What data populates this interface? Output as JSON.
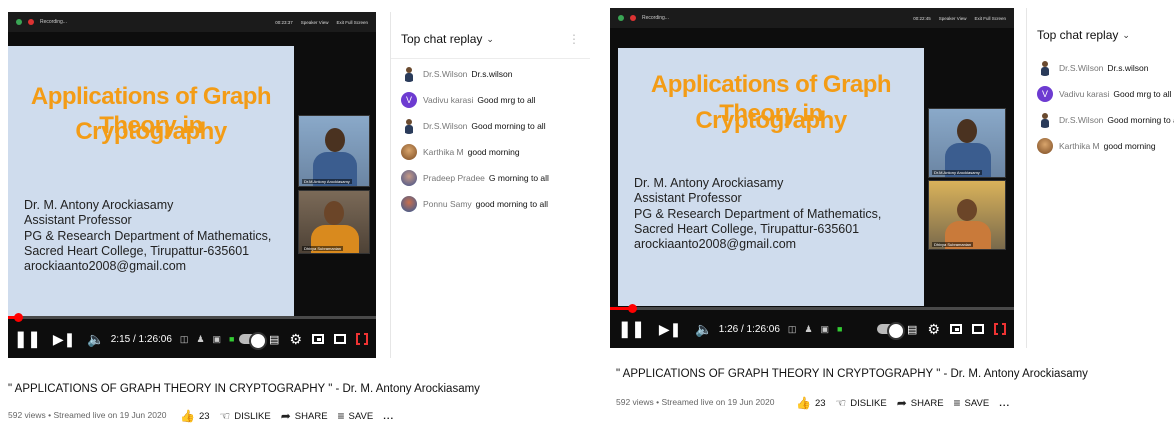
{
  "screens": [
    {
      "id": "left",
      "player": {
        "recording_label": "Recording...",
        "top_right": [
          "00:23:37",
          "Speaker View",
          "Exit Full Screen"
        ],
        "slide": {
          "title_line1": "Applications of Graph Theory in",
          "title_line2": "Cryptography",
          "lines": [
            "Dr. M. Antony Arockiasamy",
            "Assistant Professor",
            "PG & Research Department of Mathematics,",
            "Sacred Heart College, Tirupattur-635601",
            "arockiaanto2008@gmail.com"
          ]
        },
        "cam_labels": [
          "Dr.M.Antony Arockiasamy",
          "Dhivya Subramanian"
        ],
        "progress_fraction": 0.027,
        "time": "2:15 / 1:26:06",
        "mini_controls": [
          "Security",
          "Participants",
          "Chat",
          "Share Screen",
          "Record",
          "Reactions"
        ]
      },
      "chat": {
        "header": "Top chat replay",
        "messages": [
          {
            "author": "Dr.S.Wilson",
            "text": "Dr.s.wilson",
            "avatar": "person",
            "color": "#ffffff"
          },
          {
            "author": "Vadivu karasi",
            "text": "Good mrg to all",
            "avatar": "V",
            "color": "#6d3bd1"
          },
          {
            "author": "Dr.S.Wilson",
            "text": "Good morning to all",
            "avatar": "person",
            "color": "#ffffff"
          },
          {
            "author": "Karthika M",
            "text": "good morning",
            "avatar": "photo",
            "color": "#9b6a3a"
          },
          {
            "author": "Pradeep Pradee",
            "text": "G morning to all",
            "avatar": "photo",
            "color": "#4a6fb0"
          },
          {
            "author": "Ponnu Samy",
            "text": "good morning to all",
            "avatar": "photo",
            "color": "#a3523a"
          }
        ]
      },
      "video_title": "\" APPLICATIONS OF GRAPH THEORY IN CRYPTOGRAPHY \" - Dr. M. Antony Arockiasamy",
      "meta": "592 views • Streamed live on 19 Jun 2020",
      "actions": {
        "likes": "23",
        "dislike": "DISLIKE",
        "share": "SHARE",
        "save": "SAVE",
        "more": "..."
      }
    },
    {
      "id": "right",
      "player": {
        "recording_label": "Recording...",
        "top_right": [
          "00:22:45",
          "Speaker View",
          "Exit Full Screen"
        ],
        "slide": {
          "title_line1": "Applications of Graph Theory in",
          "title_line2": "Cryptography",
          "lines": [
            "Dr. M. Antony Arockiasamy",
            "Assistant Professor",
            "PG & Research Department of Mathematics,",
            "Sacred Heart College, Tirupattur-635601",
            "arockiaanto2008@gmail.com"
          ]
        },
        "cam_labels": [
          "Dr.M.Antony Arockiasamy",
          "Dhivya Subramanian"
        ],
        "progress_fraction": 0.017,
        "time": "1:26 / 1:26:06",
        "mini_controls": [
          "Security",
          "Participants",
          "Chat",
          "Share Screen",
          "Record",
          "Reactions"
        ]
      },
      "chat": {
        "header": "Top chat replay",
        "messages": [
          {
            "author": "Dr.S.Wilson",
            "text": "Dr.s.wilson",
            "avatar": "person",
            "color": "#ffffff"
          },
          {
            "author": "Vadivu karasi",
            "text": "Good mrg to all",
            "avatar": "V",
            "color": "#6d3bd1"
          },
          {
            "author": "Dr.S.Wilson",
            "text": "Good morning to all",
            "avatar": "person",
            "color": "#ffffff"
          },
          {
            "author": "Karthika M",
            "text": "good morning",
            "avatar": "photo",
            "color": "#9b6a3a"
          }
        ]
      },
      "video_title": "\" APPLICATIONS OF GRAPH THEORY IN CRYPTOGRAPHY \" - Dr. M. Antony Arockiasamy",
      "meta": "592 views • Streamed live on 19 Jun 2020",
      "actions": {
        "likes": "23",
        "dislike": "DISLIKE",
        "share": "SHARE",
        "save": "SAVE",
        "more": "..."
      }
    }
  ],
  "colors": {
    "slide_title": "#f39c16",
    "progress": "#ff0000",
    "slide_bg": "#cfdced"
  }
}
